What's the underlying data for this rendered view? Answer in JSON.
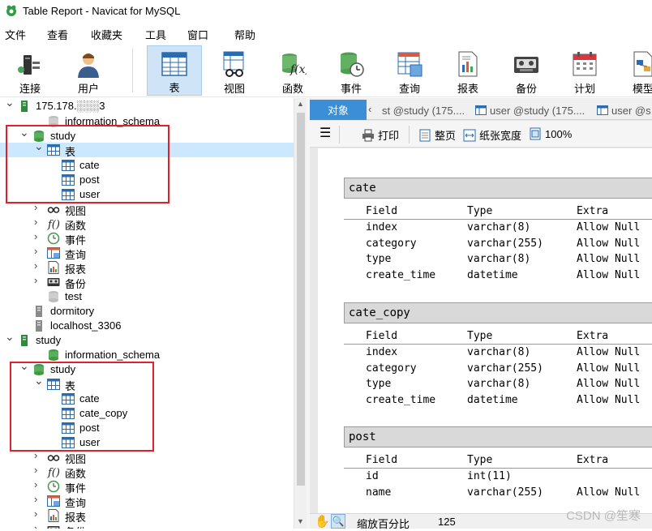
{
  "window": {
    "title": "Table Report - Navicat for MySQL"
  },
  "menu": [
    "文件",
    "查看",
    "收藏夹",
    "工具",
    "窗口",
    "帮助"
  ],
  "toolbar": {
    "items": [
      {
        "label": "连接",
        "icon": "connection-icon"
      },
      {
        "label": "用户",
        "icon": "user-icon"
      },
      {
        "label": "表",
        "icon": "table-icon",
        "active": true
      },
      {
        "label": "视图",
        "icon": "view-icon"
      },
      {
        "label": "函数",
        "icon": "function-icon"
      },
      {
        "label": "事件",
        "icon": "event-icon"
      },
      {
        "label": "查询",
        "icon": "query-icon"
      },
      {
        "label": "报表",
        "icon": "report-icon"
      },
      {
        "label": "备份",
        "icon": "backup-icon"
      },
      {
        "label": "计划",
        "icon": "schedule-icon"
      },
      {
        "label": "模型",
        "icon": "model-icon"
      }
    ]
  },
  "tree": {
    "rows": [
      {
        "label": "175.178.░░░3",
        "level": 0,
        "arrow": "down",
        "icon": "server-green"
      },
      {
        "label": "information_schema",
        "level": 2,
        "icon": "db-gray"
      },
      {
        "label": "study",
        "level": 1,
        "arrow": "down",
        "icon": "db-green"
      },
      {
        "label": "表",
        "level": 2,
        "arrow": "down",
        "icon": "table-folder",
        "selected": true
      },
      {
        "label": "cate",
        "level": 3,
        "icon": "table"
      },
      {
        "label": "post",
        "level": 3,
        "icon": "table"
      },
      {
        "label": "user",
        "level": 3,
        "icon": "table"
      },
      {
        "label": "视图",
        "level": 2,
        "arrow": "right",
        "icon": "view"
      },
      {
        "label": "函数",
        "level": 2,
        "arrow": "right",
        "icon": "function"
      },
      {
        "label": "事件",
        "level": 2,
        "arrow": "right",
        "icon": "event"
      },
      {
        "label": "查询",
        "level": 2,
        "arrow": "right",
        "icon": "query"
      },
      {
        "label": "报表",
        "level": 2,
        "arrow": "right",
        "icon": "report"
      },
      {
        "label": "备份",
        "level": 2,
        "arrow": "right",
        "icon": "backup"
      },
      {
        "label": "test",
        "level": 2,
        "icon": "db-gray"
      },
      {
        "label": "dormitory",
        "level": 1,
        "icon": "server-gray"
      },
      {
        "label": "localhost_3306",
        "level": 1,
        "icon": "server-gray"
      },
      {
        "label": "study",
        "level": 0,
        "arrow": "down",
        "icon": "server-green"
      },
      {
        "label": "information_schema",
        "level": 2,
        "icon": "db-green"
      },
      {
        "label": "study",
        "level": 1,
        "arrow": "down",
        "icon": "db-green"
      },
      {
        "label": "表",
        "level": 2,
        "arrow": "down",
        "icon": "table-folder"
      },
      {
        "label": "cate",
        "level": 3,
        "icon": "table"
      },
      {
        "label": "cate_copy",
        "level": 3,
        "icon": "table"
      },
      {
        "label": "post",
        "level": 3,
        "icon": "table"
      },
      {
        "label": "user",
        "level": 3,
        "icon": "table"
      },
      {
        "label": "视图",
        "level": 2,
        "arrow": "right",
        "icon": "view"
      },
      {
        "label": "函数",
        "level": 2,
        "arrow": "right",
        "icon": "function"
      },
      {
        "label": "事件",
        "level": 2,
        "arrow": "right",
        "icon": "event"
      },
      {
        "label": "查询",
        "level": 2,
        "arrow": "right",
        "icon": "query"
      },
      {
        "label": "报表",
        "level": 2,
        "arrow": "right",
        "icon": "report"
      },
      {
        "label": "备份",
        "level": 2,
        "arrow": "right",
        "icon": "backup"
      }
    ]
  },
  "tabs": {
    "object": "对象",
    "nav": "‹",
    "items": [
      "st @study (175....",
      "user @study (175....",
      "user @s"
    ]
  },
  "report_toolbar": {
    "print": "打印",
    "whole_page": "整页",
    "page_width": "纸张宽度",
    "zoom": "100%"
  },
  "report": {
    "columns": [
      "Field",
      "Type",
      "Extra"
    ],
    "tables": [
      {
        "name": "cate",
        "rows": [
          [
            "index",
            "varchar(8)",
            "Allow Null"
          ],
          [
            "category",
            "varchar(255)",
            "Allow Null"
          ],
          [
            "type",
            "varchar(8)",
            "Allow Null"
          ],
          [
            "create_time",
            "datetime",
            "Allow Null"
          ]
        ]
      },
      {
        "name": "cate_copy",
        "rows": [
          [
            "index",
            "varchar(8)",
            "Allow Null"
          ],
          [
            "category",
            "varchar(255)",
            "Allow Null"
          ],
          [
            "type",
            "varchar(8)",
            "Allow Null"
          ],
          [
            "create_time",
            "datetime",
            "Allow Null"
          ]
        ]
      },
      {
        "name": "post",
        "rows": [
          [
            "id",
            "int(11)",
            ""
          ],
          [
            "name",
            "varchar(255)",
            "Allow Null"
          ]
        ]
      }
    ]
  },
  "status": {
    "zoom_label": "缩放百分比",
    "zoom_value": "125"
  },
  "watermark": "CSDN @笙寒",
  "colors": {
    "accent": "#3c8fd6",
    "highlight": "#e0202a",
    "selected": "#cce8ff"
  }
}
